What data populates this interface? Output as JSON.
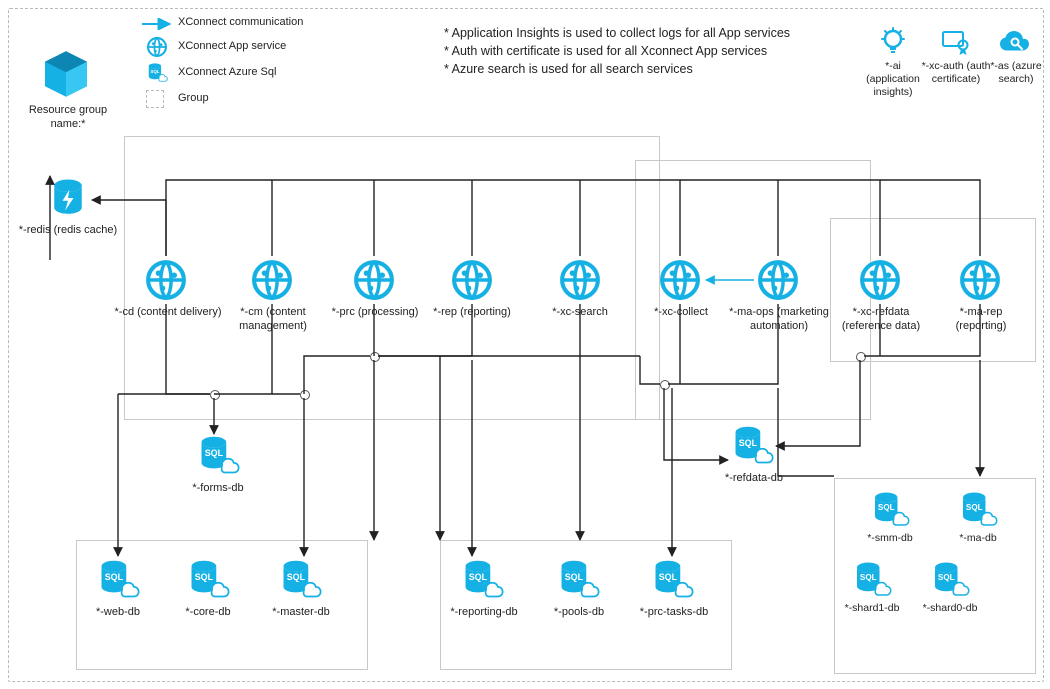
{
  "resource_group_label": "Resource group name:*",
  "legend": {
    "comm": "XConnect communication",
    "app": "XConnect App service",
    "sql": "XConnect Azure Sql",
    "group": "Group"
  },
  "notes": {
    "n1": "* Application Insights is used to collect logs for all App services",
    "n2": "* Auth with certificate is used for all Xconnect App services",
    "n3": "* Azure search is used for all search services"
  },
  "top_icons": {
    "ai": "*-ai (application insights)",
    "auth": "*-xc-auth (auth certificate)",
    "search": "*-as (azure search)"
  },
  "redis": "*-redis (redis cache)",
  "services": {
    "cd": "*-cd (content delivery)",
    "cm": "*-cm (content management)",
    "prc": "*-prc (processing)",
    "rep": "*-rep (reporting)",
    "xcsearch": "*-xc-search",
    "xccollect": "*-xc-collect",
    "maops": "*-ma-ops (marketing automation)",
    "xcrefdata": "*-xc-refdata (reference data)",
    "marep": "*-ma-rep (reporting)"
  },
  "dbs": {
    "forms": "*-forms-db",
    "refdata": "*-refdata-db",
    "web": "*-web-db",
    "core": "*-core-db",
    "master": "*-master-db",
    "reporting": "*-reporting-db",
    "pools": "*-pools-db",
    "prctasks": "*-prc-tasks-db",
    "smm": "*-smm-db",
    "ma": "*-ma-db",
    "shard1": "*-shard1-db",
    "shard0": "*-shard0-db"
  }
}
